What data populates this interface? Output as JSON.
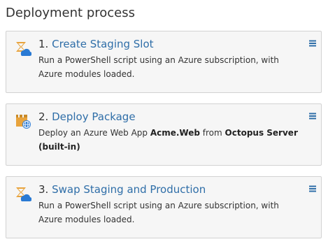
{
  "page": {
    "title": "Deployment process"
  },
  "steps": [
    {
      "number": "1.",
      "name": "Create Staging Slot",
      "icon": "azure-powershell-icon",
      "description": "Run a PowerShell script using an Azure subscription, with Azure modules loaded."
    },
    {
      "number": "2.",
      "name": "Deploy Package",
      "icon": "azure-web-app-icon",
      "description_prefix": "Deploy an Azure Web App ",
      "package": "Acme.Web",
      "description_mid": " from ",
      "feed": "Octopus Server (built-in)"
    },
    {
      "number": "3.",
      "name": "Swap Staging and Production",
      "icon": "azure-powershell-icon",
      "description": "Run a PowerShell script using an Azure subscription, with Azure modules loaded."
    }
  ],
  "colors": {
    "link": "#2f6ea8",
    "menu": "#2f6ea8",
    "card_bg": "#f6f6f6",
    "card_border": "#d2d2d2",
    "icon_orange": "#e8a33c",
    "icon_blue": "#2a7ad4"
  }
}
